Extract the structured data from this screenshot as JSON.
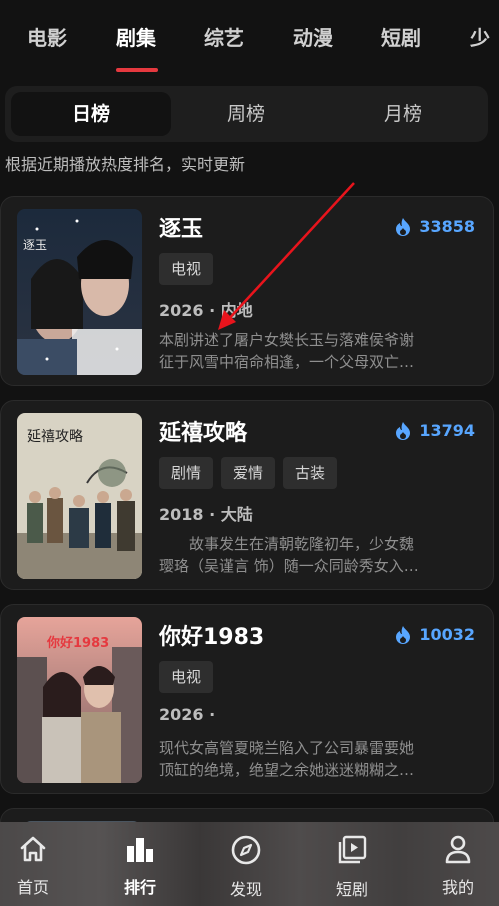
{
  "top_tabs": [
    "电影",
    "剧集",
    "综艺",
    "动漫",
    "短剧",
    "少"
  ],
  "ranking_tabs": [
    "日榜",
    "周榜",
    "月榜"
  ],
  "subtitle": "根据近期播放热度排名，实时更新",
  "shows": [
    {
      "title": "逐玉",
      "hot": "33858",
      "tags": [
        "电视"
      ],
      "meta": "2026 · 内地",
      "desc": [
        "本剧讲述了屠户女樊长玉与落难侯爷谢",
        "征于风雪中宿命相逢，一个父母双亡…"
      ],
      "poster_text": "逐玉"
    },
    {
      "title": "延禧攻略",
      "hot": "13794",
      "tags": [
        "剧情",
        "爱情",
        "古装"
      ],
      "meta": "2018 · 大陆",
      "desc": [
        "　　故事发生在清朝乾隆初年，少女魏",
        "璎珞（吴谨言 饰）随一众同龄秀女入…"
      ],
      "poster_text": "延禧攻略"
    },
    {
      "title": "你好1983",
      "hot": "10032",
      "tags": [
        "电视"
      ],
      "meta": "2026 ·",
      "desc": [
        "现代女高管夏晓兰陷入了公司暴雷要她",
        "顶缸的绝境，绝望之余她迷迷糊糊之…"
      ],
      "poster_text": "你好1983"
    }
  ],
  "bottom_nav": [
    "首页",
    "排行",
    "发现",
    "短剧",
    "我的"
  ],
  "colors": {
    "accent_red": "#e5393f",
    "hot_blue": "#58a6ff"
  },
  "icons": {
    "hot": "flame-icon",
    "nav": [
      "home-icon",
      "bar-chart-icon",
      "compass-icon",
      "play-library-icon",
      "user-icon"
    ]
  }
}
